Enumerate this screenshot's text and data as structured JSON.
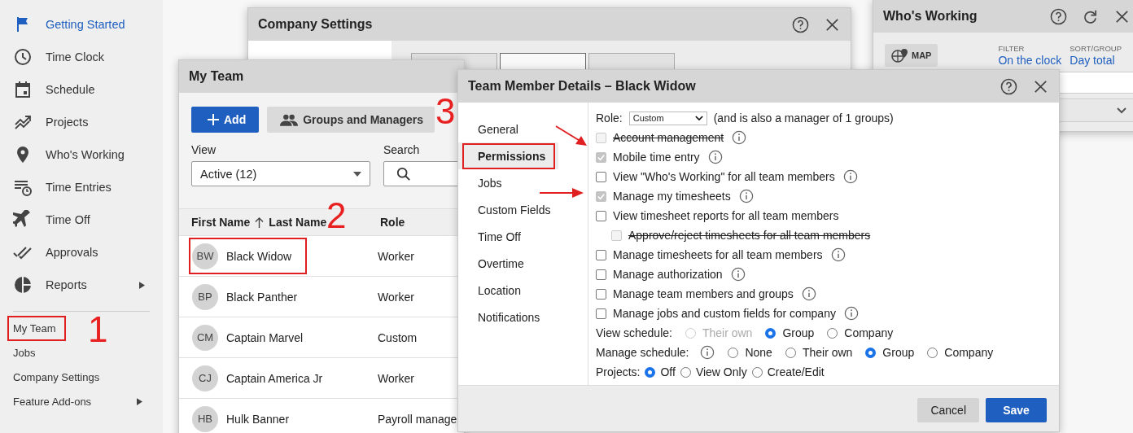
{
  "sidebar": {
    "items": [
      {
        "label": "Getting Started",
        "selected": true,
        "submenu": false
      },
      {
        "label": "Time Clock",
        "selected": false,
        "submenu": false
      },
      {
        "label": "Schedule",
        "selected": false,
        "submenu": false
      },
      {
        "label": "Projects",
        "selected": false,
        "submenu": false
      },
      {
        "label": "Who's Working",
        "selected": false,
        "submenu": false
      },
      {
        "label": "Time Entries",
        "selected": false,
        "submenu": false
      },
      {
        "label": "Time Off",
        "selected": false,
        "submenu": false
      },
      {
        "label": "Approvals",
        "selected": false,
        "submenu": false
      },
      {
        "label": "Reports",
        "selected": false,
        "submenu": true
      }
    ],
    "links": [
      {
        "label": "My Team",
        "highlighted": true,
        "submenu": false
      },
      {
        "label": "Jobs",
        "highlighted": false,
        "submenu": false
      },
      {
        "label": "Company Settings",
        "highlighted": false,
        "submenu": false
      },
      {
        "label": "Feature Add-ons",
        "highlighted": false,
        "submenu": true
      }
    ]
  },
  "company_settings": {
    "title": "Company Settings",
    "tabs": [
      {
        "selected": false
      },
      {
        "selected": true
      },
      {
        "selected": false
      }
    ]
  },
  "whos_working": {
    "title": "Who's Working",
    "map_button": "MAP",
    "filter_label": "FILTER",
    "filter_value": "On the clock",
    "sort_label": "SORT/GROUP",
    "sort_value": "Day total"
  },
  "my_team": {
    "title": "My Team",
    "add_button": "Add",
    "groups_button": "Groups and Managers",
    "view_label": "View",
    "view_value": "Active (12)",
    "search_label": "Search",
    "columns": [
      "First Name",
      "Last Name",
      "Role"
    ],
    "rows": [
      {
        "initials": "BW",
        "name": "Black Widow",
        "role": "Worker",
        "highlighted": true
      },
      {
        "initials": "BP",
        "name": "Black Panther",
        "role": "Worker",
        "highlighted": false
      },
      {
        "initials": "CM",
        "name": "Captain Marvel",
        "role": "Custom",
        "highlighted": false
      },
      {
        "initials": "CJ",
        "name": "Captain America Jr",
        "role": "Worker",
        "highlighted": false
      },
      {
        "initials": "HB",
        "name": "Hulk Banner",
        "role": "Payroll manage",
        "highlighted": false
      }
    ]
  },
  "details": {
    "title": "Team Member Details – Black Widow",
    "nav": [
      {
        "label": "General",
        "selected": false,
        "highlighted": false
      },
      {
        "label": "Permissions",
        "selected": true,
        "highlighted": true
      },
      {
        "label": "Jobs",
        "selected": false,
        "highlighted": false
      },
      {
        "label": "Custom Fields",
        "selected": false,
        "highlighted": false
      },
      {
        "label": "Time Off",
        "selected": false,
        "highlighted": false
      },
      {
        "label": "Overtime",
        "selected": false,
        "highlighted": false
      },
      {
        "label": "Location",
        "selected": false,
        "highlighted": false
      },
      {
        "label": "Notifications",
        "selected": false,
        "highlighted": false
      }
    ],
    "role_label": "Role:",
    "role_value": "Custom",
    "role_note": "(and is also a manager of 1 groups)",
    "permissions": [
      {
        "label": "Account management",
        "checked": false,
        "disabled": true,
        "struck": true,
        "info": true,
        "indent": false
      },
      {
        "label": "Mobile time entry",
        "checked": true,
        "disabled": true,
        "struck": false,
        "info": true,
        "indent": false
      },
      {
        "label": "View \"Who's Working\" for all team members",
        "checked": false,
        "disabled": false,
        "struck": false,
        "info": true,
        "indent": false
      },
      {
        "label": "Manage my timesheets",
        "checked": true,
        "disabled": true,
        "struck": false,
        "info": true,
        "indent": false
      },
      {
        "label": "View timesheet reports for all team members",
        "checked": false,
        "disabled": false,
        "struck": false,
        "info": false,
        "indent": false
      },
      {
        "label": "Approve/reject timesheets for all team members",
        "checked": false,
        "disabled": true,
        "struck": true,
        "info": false,
        "indent": true
      },
      {
        "label": "Manage timesheets for all team members",
        "checked": false,
        "disabled": false,
        "struck": false,
        "info": true,
        "indent": false
      },
      {
        "label": "Manage authorization",
        "checked": false,
        "disabled": false,
        "struck": false,
        "info": true,
        "indent": false
      },
      {
        "label": "Manage team members and groups",
        "checked": false,
        "disabled": false,
        "struck": false,
        "info": true,
        "indent": false
      },
      {
        "label": "Manage jobs and custom fields for company",
        "checked": false,
        "disabled": false,
        "struck": false,
        "info": true,
        "indent": false
      }
    ],
    "radio_groups": [
      {
        "label": "View schedule:",
        "info": false,
        "options": [
          {
            "label": "Their own",
            "selected": false,
            "disabled": true
          },
          {
            "label": "Group",
            "selected": true,
            "disabled": false
          },
          {
            "label": "Company",
            "selected": false,
            "disabled": false
          }
        ]
      },
      {
        "label": "Manage schedule:",
        "info": true,
        "options": [
          {
            "label": "None",
            "selected": false,
            "disabled": false
          },
          {
            "label": "Their own",
            "selected": false,
            "disabled": false
          },
          {
            "label": "Group",
            "selected": true,
            "disabled": false
          },
          {
            "label": "Company",
            "selected": false,
            "disabled": false
          }
        ]
      },
      {
        "label": "Projects:",
        "info": false,
        "options": [
          {
            "label": "Off",
            "selected": true,
            "disabled": false
          },
          {
            "label": "View Only",
            "selected": false,
            "disabled": false
          },
          {
            "label": "Create/Edit",
            "selected": false,
            "disabled": false
          }
        ]
      }
    ],
    "cancel_button": "Cancel",
    "save_button": "Save"
  },
  "annotations": [
    {
      "kind": "number",
      "text": "1"
    },
    {
      "kind": "number",
      "text": "2"
    },
    {
      "kind": "number",
      "text": "3"
    },
    {
      "kind": "arrow"
    },
    {
      "kind": "arrow"
    }
  ]
}
